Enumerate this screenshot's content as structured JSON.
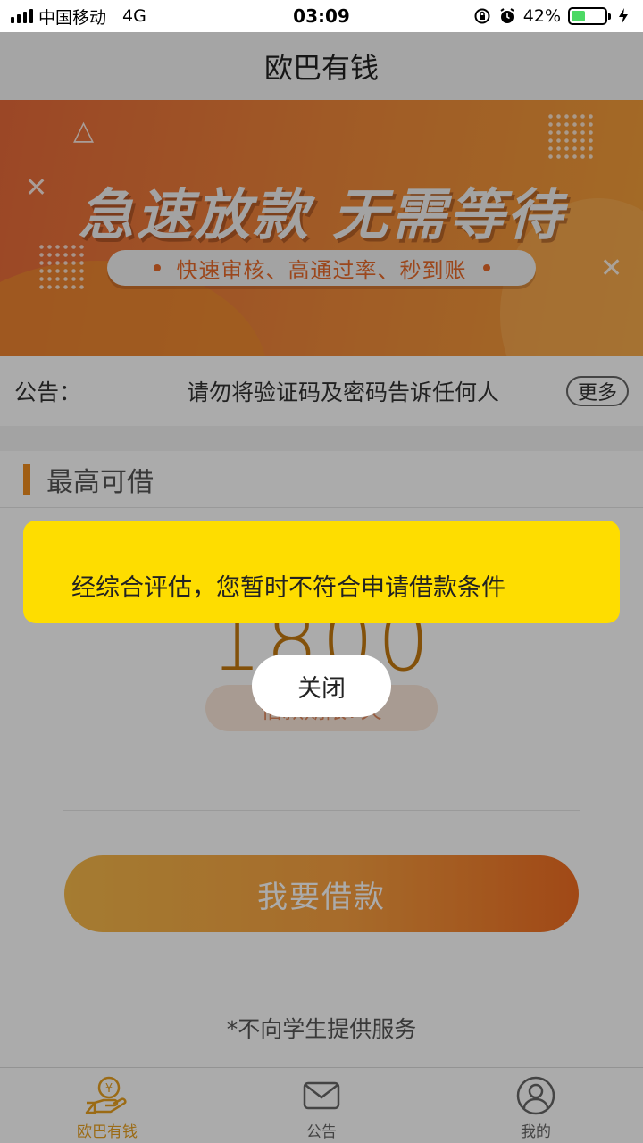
{
  "status_bar": {
    "carrier": "中国移动",
    "network": "4G",
    "time": "03:09",
    "battery_percent": "42%",
    "battery_level": 0.42
  },
  "nav": {
    "title": "欧巴有钱"
  },
  "banner": {
    "headline": "急速放款 无需等待",
    "tagline": "快速审核、高通过率、秒到账"
  },
  "notice": {
    "label": "公告：",
    "text": "请勿将验证码及密码告诉任何人",
    "more_label": "更多"
  },
  "loan": {
    "section_title": "最高可借",
    "amount": "1800",
    "term_text": "借款期限7天",
    "apply_button": "我要借款",
    "disclaimer": "*不向学生提供服务"
  },
  "tabs": [
    {
      "label": "欧巴有钱",
      "icon": "coin-hand-icon",
      "active": true
    },
    {
      "label": "公告",
      "icon": "mail-icon",
      "active": false
    },
    {
      "label": "我的",
      "icon": "user-icon",
      "active": false
    }
  ],
  "dialog": {
    "message": "经综合评估，您暂时不符合申请借款条件",
    "close_label": "关闭"
  },
  "colors": {
    "accent": "#ef8c1e",
    "toast_bg": "#fedd00",
    "tab_active": "#e8a020"
  }
}
